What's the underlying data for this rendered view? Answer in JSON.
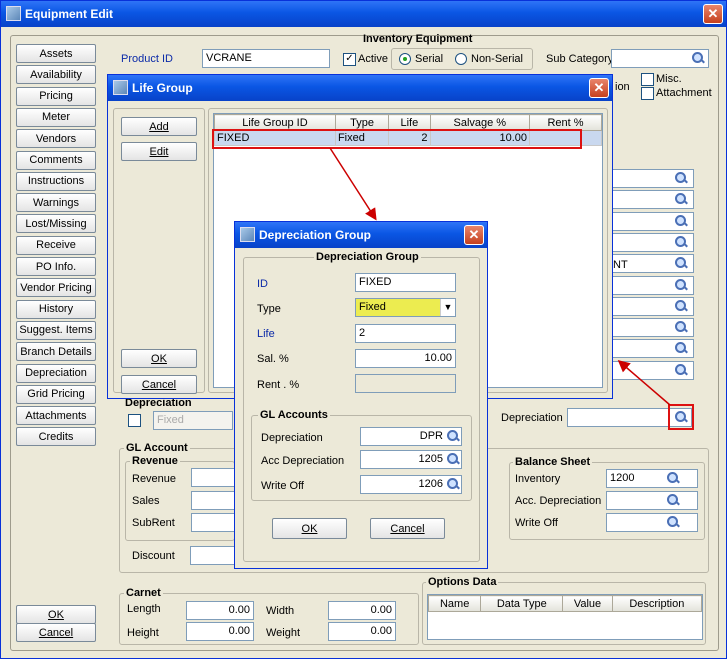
{
  "main": {
    "title": "Equipment Edit",
    "close": "✕"
  },
  "sidebar": {
    "items": [
      "Assets",
      "Availability",
      "Pricing",
      "Meter",
      "Vendors",
      "Comments",
      "Instructions",
      "Warnings",
      "Lost/Missing",
      "Receive",
      "PO Info.",
      "Vendor Pricing",
      "History",
      "Suggest. Items",
      "Branch Details",
      "Depreciation",
      "Grid Pricing",
      "Attachments",
      "Credits"
    ],
    "ok": "OK",
    "cancel": "Cancel"
  },
  "inventory": {
    "title": "Inventory Equipment",
    "product_id_label": "Product ID",
    "product_id": "VCRANE",
    "active": "Active",
    "serial": "Serial",
    "non_serial": "Non-Serial",
    "sub_category": "Sub Category",
    "misc": "Misc.",
    "attachment": "Attachment",
    "partial_on": "ion",
    "partial_nt": "NT"
  },
  "dep_section": {
    "title": "Depreciation",
    "fixed": "Fixed",
    "dep_label": "Depreciation"
  },
  "gl": {
    "title": "GL Account",
    "revenue_title": "Revenue",
    "revenue": "Revenue",
    "sales": "Sales",
    "subrent": "SubRent",
    "discount": "Discount",
    "balance_title": "Balance Sheet",
    "inventory": "Inventory",
    "inventory_val": "1200",
    "acc_dep": "Acc. Depreciation",
    "write_off": "Write Off"
  },
  "carnet": {
    "title": "Carnet",
    "length": "Length",
    "length_val": "0.00",
    "width": "Width",
    "width_val": "0.00",
    "height": "Height",
    "height_val": "0.00",
    "weight": "Weight",
    "weight_val": "0.00"
  },
  "options": {
    "title": "Options Data",
    "headers": [
      "Name",
      "Data Type",
      "Value",
      "Description"
    ]
  },
  "life": {
    "title": "Life Group",
    "add": "Add",
    "edit": "Edit",
    "ok": "OK",
    "cancel": "Cancel",
    "headers": [
      "Life Group ID",
      "Type",
      "Life",
      "Salvage %",
      "Rent %"
    ],
    "rows": [
      [
        "FIXED",
        "Fixed",
        "2",
        "10.00",
        ""
      ]
    ]
  },
  "dep": {
    "title": "Depreciation Group",
    "group_title": "Depreciation Group",
    "id_label": "ID",
    "id": "FIXED",
    "type_label": "Type",
    "type": "Fixed",
    "life_label": "Life",
    "life": "2",
    "sal_label": "Sal. %",
    "sal": "10.00",
    "rent_label": "Rent . %",
    "gl_title": "GL Accounts",
    "dep_label": "Depreciation",
    "dep_val": "DPR",
    "acc_label": "Acc Depreciation",
    "acc_val": "1205",
    "wo_label": "Write Off",
    "wo_val": "1206",
    "ok": "OK",
    "cancel": "Cancel"
  }
}
